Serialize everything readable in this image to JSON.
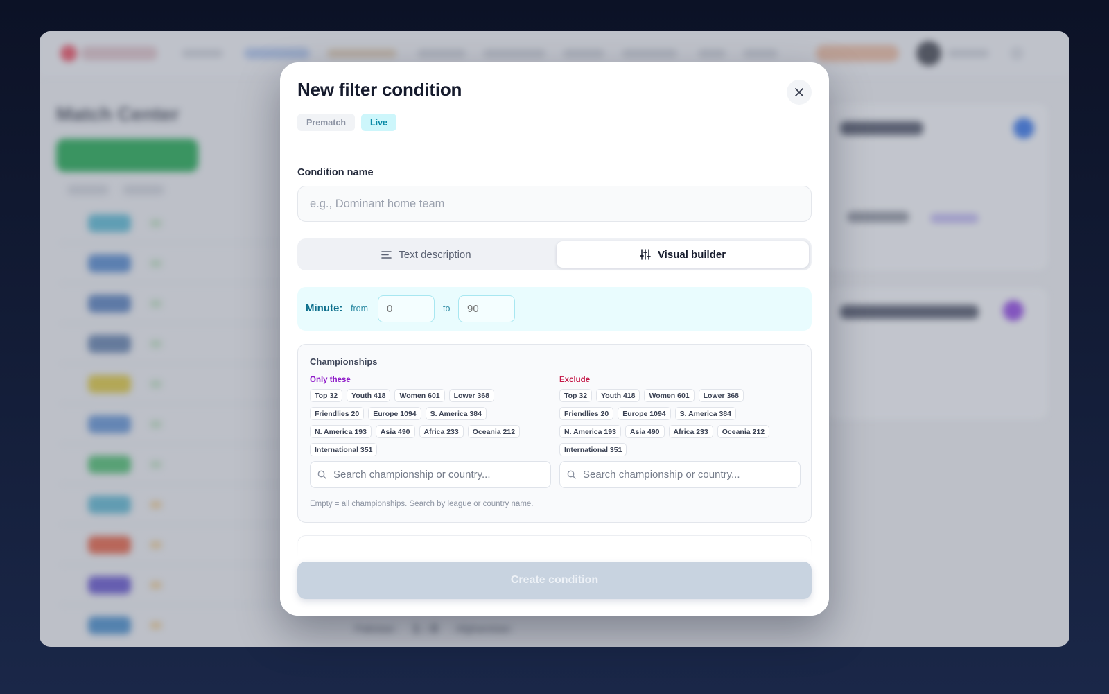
{
  "modal": {
    "title": "New filter condition",
    "mode_tabs": [
      {
        "label": "Prematch",
        "active": false
      },
      {
        "label": "Live",
        "active": true
      }
    ],
    "condition_name": {
      "label": "Condition name",
      "placeholder": "e.g., Dominant home team",
      "value": ""
    },
    "builder_tabs": [
      {
        "label": "Text description",
        "icon": "lines-icon",
        "active": false
      },
      {
        "label": "Visual builder",
        "icon": "sliders-icon",
        "active": true
      }
    ],
    "minute": {
      "label": "Minute:",
      "from_label": "from",
      "to_label": "to",
      "from_placeholder": "0",
      "to_placeholder": "90"
    },
    "championships": {
      "title": "Championships",
      "only_label": "Only these",
      "exclude_label": "Exclude",
      "chips": [
        "Top 32",
        "Youth 418",
        "Women 601",
        "Lower 368",
        "Friendlies 20",
        "Europe 1094",
        "S. America 384",
        "N. America 193",
        "Asia 490",
        "Africa 233",
        "Oceania 212",
        "International 351"
      ],
      "search_placeholder": "Search championship or country...",
      "hint": "Empty = all championships. Search by league or country name."
    },
    "create_button": "Create condition"
  },
  "background": {
    "page_heading": "Match Center",
    "footer_teams": {
      "home": "Pakistan",
      "score": "1 : 0",
      "away": "Afghanistan"
    }
  },
  "colors": {
    "accent_live": "#0a8aa6",
    "only_label": "#8e19c8",
    "exclude_label": "#c41747",
    "button_disabled": "#c8d3e0"
  }
}
